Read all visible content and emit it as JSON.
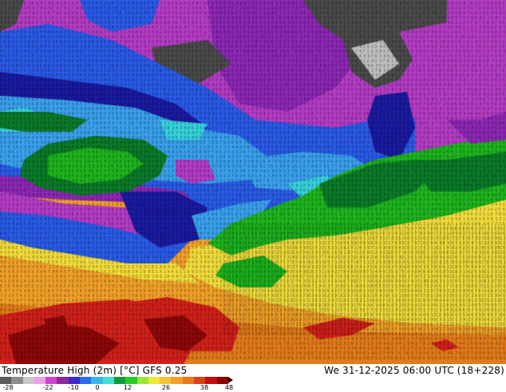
{
  "map": {
    "title": "Temperature High (2m) [°C] GFS 0.25",
    "date": "We 31-12-2025 06:00 UTC (18+228)",
    "field": "temperature-high-2m"
  },
  "legend": {
    "ticks": [
      "-28",
      "-22",
      "-10",
      "0",
      "12",
      "26",
      "38",
      "48"
    ],
    "colors": [
      "#5a5a5a",
      "#8c8c8c",
      "#c9c9c9",
      "#e9a0e9",
      "#cc44cc",
      "#8a2a9a",
      "#3a2ac8",
      "#2a6cf0",
      "#36b8e6",
      "#42e0d6",
      "#0f9a3a",
      "#2ac82a",
      "#9ae63c",
      "#f0e63c",
      "#f2c23a",
      "#f0a030",
      "#e8781e",
      "#d8421a",
      "#c01010",
      "#8a0000"
    ]
  },
  "palette": {
    "grey_dark": "#4a4a4a",
    "grey_light": "#bfbfbf",
    "magenta": "#b43cc4",
    "purple": "#8c28b4",
    "blue_dark": "#1a1aa0",
    "blue": "#2a5ae6",
    "light_blue": "#3aa0ec",
    "cyan": "#36d2dc",
    "green_dark": "#0a7a28",
    "green": "#1eb41e",
    "yellow": "#f0dc3c",
    "orange": "#f0a028",
    "dark_orange": "#e07a1a",
    "red": "#d0201a",
    "dark_red": "#8c0808"
  }
}
